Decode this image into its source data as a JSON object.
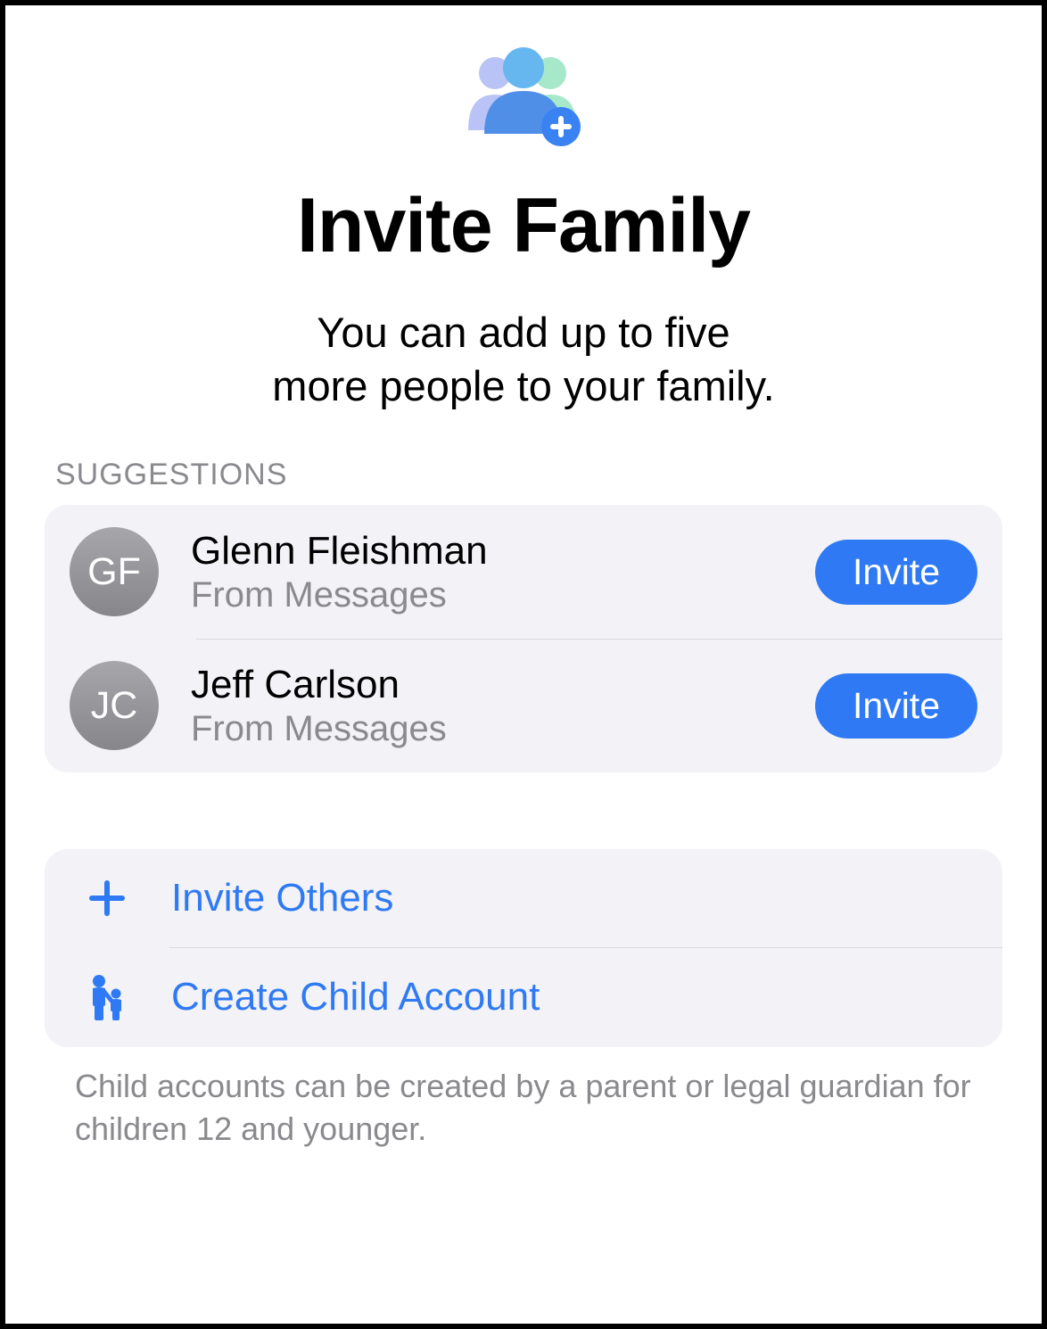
{
  "header": {
    "title": "Invite Family",
    "subtitle_line1": "You can add up to five",
    "subtitle_line2": "more people to your family."
  },
  "suggestions": {
    "label": "SUGGESTIONS",
    "items": [
      {
        "initials": "GF",
        "name": "Glenn Fleishman",
        "source": "From Messages",
        "button": "Invite"
      },
      {
        "initials": "JC",
        "name": "Jeff Carlson",
        "source": "From Messages",
        "button": "Invite"
      }
    ]
  },
  "actions": {
    "invite_others": "Invite Others",
    "create_child": "Create Child Account"
  },
  "footer": {
    "note": "Child accounts can be created by a parent or legal guardian for children 12 and younger."
  },
  "colors": {
    "accent": "#2f7af4",
    "card_bg": "#f2f2f7",
    "secondary_text": "#8a8a8e"
  }
}
